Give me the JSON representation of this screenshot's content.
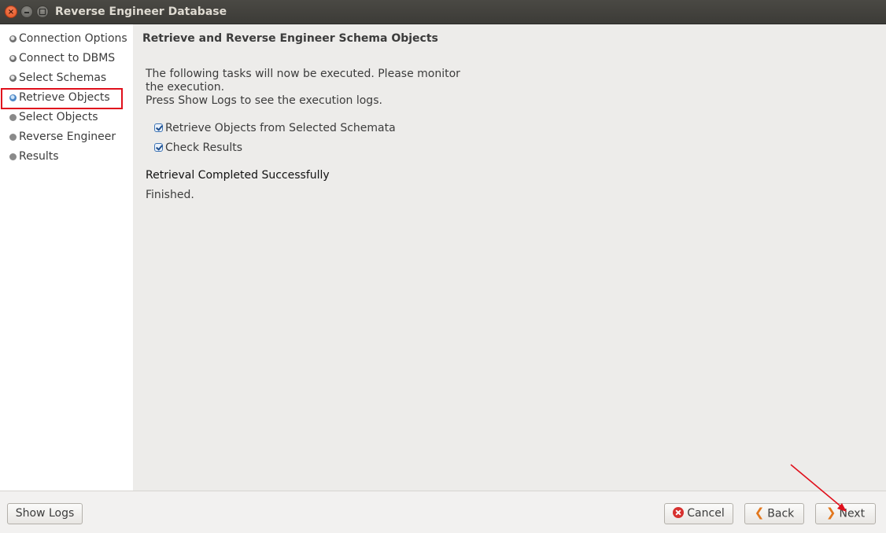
{
  "window": {
    "title": "Reverse Engineer Database"
  },
  "sidebar": {
    "steps": [
      {
        "label": "Connection Options",
        "state": "done"
      },
      {
        "label": "Connect to DBMS",
        "state": "done"
      },
      {
        "label": "Select Schemas",
        "state": "done"
      },
      {
        "label": "Retrieve Objects",
        "state": "current"
      },
      {
        "label": "Select Objects",
        "state": "pending"
      },
      {
        "label": "Reverse Engineer",
        "state": "pending"
      },
      {
        "label": "Results",
        "state": "pending"
      }
    ]
  },
  "main": {
    "title": "Retrieve and Reverse Engineer Schema Objects",
    "description_line1": "The following tasks will now be executed. Please monitor",
    "description_line2": "the execution.",
    "description_line3": "Press Show Logs to see the execution logs.",
    "tasks": [
      {
        "label": "Retrieve Objects from Selected Schemata",
        "checked": true
      },
      {
        "label": "Check Results",
        "checked": true
      }
    ],
    "status_title": "Retrieval Completed Successfully",
    "status_detail": "Finished."
  },
  "footer": {
    "show_logs_label": "Show Logs",
    "cancel_label": "Cancel",
    "back_label": "Back",
    "next_label": "Next"
  },
  "colors": {
    "highlight": "#e0101c",
    "annotation_arrow": "#e0101c",
    "current_step_dot": "#4a86c5",
    "chevron": "#e2771d",
    "cancel_icon": "#d7312f"
  },
  "icons": {
    "close": "close-icon",
    "minimize": "minimize-icon",
    "maximize": "maximize-icon",
    "check": "checkmark-icon",
    "cancel": "cancel-icon",
    "back": "chevron-left-icon",
    "next": "chevron-right-icon"
  }
}
